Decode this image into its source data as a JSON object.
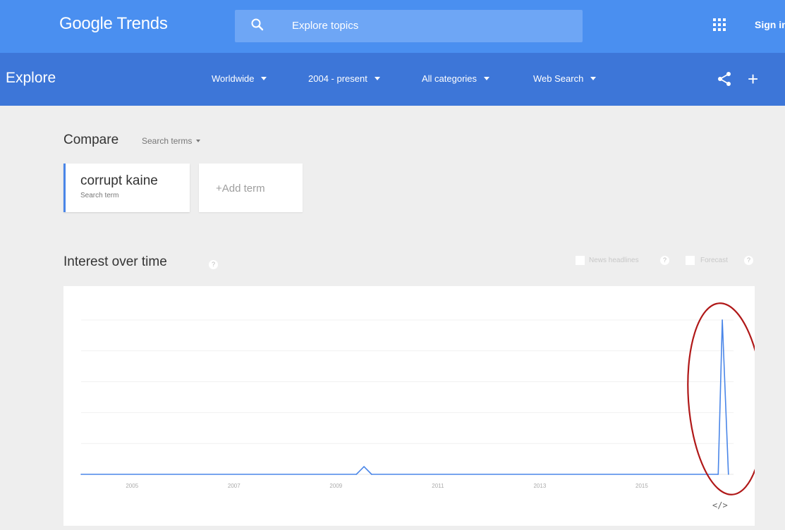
{
  "header": {
    "logo": "Google Trends",
    "search_placeholder": "Explore topics",
    "sign_in": "Sign in"
  },
  "subbar": {
    "title": "Explore",
    "filters": [
      "Worldwide",
      "2004 - present",
      "All categories",
      "Web Search"
    ]
  },
  "compare": {
    "title": "Compare",
    "mode": "Search terms",
    "term": {
      "name": "corrupt kaine",
      "type": "Search term"
    },
    "add_term": "+Add term"
  },
  "interest": {
    "title": "Interest over time",
    "help": "?",
    "options": [
      "News headlines",
      "Forecast"
    ]
  },
  "colors": {
    "topbar": "#4a8ff0",
    "subbar": "#3d76d8",
    "series": "#4a86e8",
    "annotation": "#b01818"
  },
  "icons": {
    "search": "search-icon",
    "apps": "apps-grid-icon",
    "share": "share-icon",
    "add": "plus-icon",
    "embed": "embed-code-icon"
  },
  "chart_data": {
    "type": "line",
    "x_tick_labels": [
      "2005",
      "2007",
      "2009",
      "2011",
      "2013",
      "2015"
    ],
    "x": [
      2004.0,
      2009.4,
      2009.55,
      2009.7,
      2016.5,
      2016.58,
      2016.7
    ],
    "values": [
      0,
      0,
      5,
      0,
      0,
      100,
      0
    ],
    "ylim": [
      0,
      100
    ],
    "xlim": [
      2004,
      2016.8
    ],
    "grid": true,
    "legend": "none",
    "annotation": "red ellipse around final spike",
    "embed_label": "</>"
  }
}
